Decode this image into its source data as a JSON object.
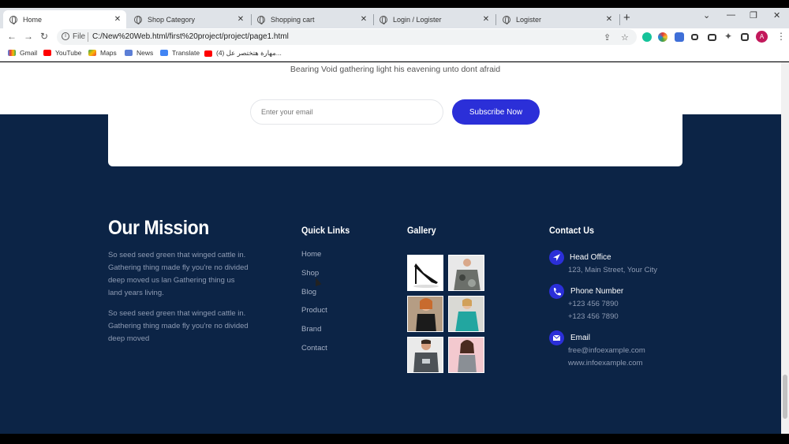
{
  "browser": {
    "tabs": [
      {
        "title": "Home",
        "active": true
      },
      {
        "title": "Shop Category"
      },
      {
        "title": "Shopping cart"
      },
      {
        "title": "Login / Logister"
      },
      {
        "title": "Logister"
      }
    ],
    "new_tab": "+",
    "address": {
      "scheme": "File",
      "url": "C:/New%20Web.html/first%20project/project/page1.html"
    },
    "bookmarks": [
      "Gmail",
      "YouTube",
      "Maps",
      "News",
      "Translate",
      "(4) مهارة هتختصر عل..."
    ],
    "profile_initial": "A"
  },
  "newsletter": {
    "text": "Bearing Void gathering light his eavening unto dont afraid",
    "email_placeholder": "Enter your email",
    "button": "Subscribe Now"
  },
  "footer": {
    "mission": {
      "title": "Our Mission",
      "p1": "So seed seed green that winged cattle in. Gathering thing made fly you're no divided deep moved us lan Gathering thing us land years living.",
      "p2": "So seed seed green that winged cattle in. Gathering thing made fly you're no divided deep moved"
    },
    "quick_links": {
      "title": "Quick Links",
      "items": [
        "Home",
        "Shop",
        "Blog",
        "Product",
        "Brand",
        "Contact"
      ]
    },
    "gallery": {
      "title": "Gallery"
    },
    "contact": {
      "title": "Contact Us",
      "office_label": "Head Office",
      "office_value": "123, Main Street, Your City",
      "phone_label": "Phone Number",
      "phone_1": "+123 456 7890",
      "phone_2": "+123 456 7890",
      "email_label": "Email",
      "email_1": "free@infoexample.com",
      "email_2": "www.infoexample.com"
    }
  },
  "colors": {
    "footer_bg": "#0c2446",
    "accent": "#2b2fd8"
  }
}
